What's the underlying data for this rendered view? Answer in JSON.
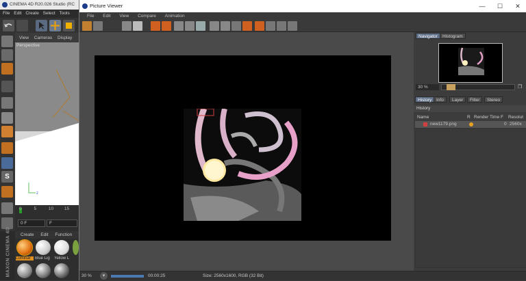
{
  "c4d": {
    "title": "CINEMA 4D R20.026 Studio (RC",
    "menu": [
      "File",
      "Edit",
      "Create",
      "Select",
      "Tools"
    ],
    "viewport_menu": [
      "View",
      "Cameras",
      "Display"
    ],
    "viewport_label": "Perspective",
    "timeline_ticks": [
      "0",
      "5",
      "10",
      "15"
    ],
    "frame_field": "0 F",
    "frame_field2": "F",
    "material_menu": [
      "Create",
      "Edit",
      "Function"
    ],
    "materials": [
      "Luminar",
      "Blue Lig",
      "Yellow L"
    ],
    "brand": "MAXON CINEMA 4D"
  },
  "pv": {
    "title": "Picture Viewer",
    "menu": [
      "File",
      "Edit",
      "View",
      "Compare",
      "Animation"
    ],
    "status": {
      "zoom": "30 %",
      "time": "00:00:25",
      "info": "Size: 2560x1600, RGB (32 Bit)"
    },
    "tabs_top": [
      "Navigator",
      "Histogram"
    ],
    "zoom": "30 %",
    "zoom_level": 0.3,
    "tabs_bottom": [
      "History",
      "Info",
      "Layer",
      "Filter",
      "Stereo"
    ],
    "history_title": "History",
    "columns": [
      "Name",
      "R",
      "Render Time",
      "F",
      "Resolut"
    ],
    "row": {
      "name": "new1179.png",
      "frame": "0",
      "res": "2560x"
    }
  },
  "colors": {
    "accent": "#5e6f87",
    "orange": "#e8a020",
    "render_pink": "#e7a0c8"
  }
}
